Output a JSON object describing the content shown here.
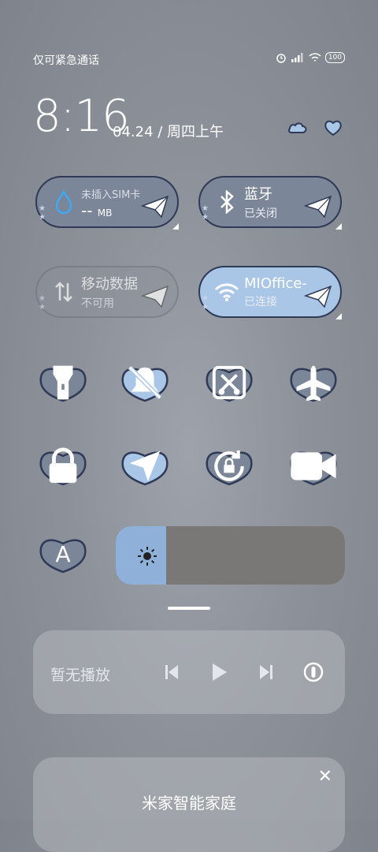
{
  "status": {
    "carrier_text": "仅可紧急通话",
    "battery": "100"
  },
  "clock": {
    "time": "8:16",
    "date": "04.24 / 周四上午"
  },
  "tiles": [
    {
      "title": "未插入SIM卡",
      "value": "-- ",
      "unit": "MB"
    },
    {
      "title": "蓝牙",
      "sub": "已关闭"
    },
    {
      "title": "移动数据",
      "sub": "不可用"
    },
    {
      "title": "MIOffice-",
      "sub": "已连接"
    }
  ],
  "toggles": [
    {
      "icon": "flashlight-icon",
      "active": false
    },
    {
      "icon": "mute-bell-icon",
      "active": true
    },
    {
      "icon": "screenshot-icon",
      "active": false
    },
    {
      "icon": "airplane-icon",
      "active": false
    },
    {
      "icon": "lock-icon",
      "active": false
    },
    {
      "icon": "location-icon",
      "active": true
    },
    {
      "icon": "rotation-lock-icon",
      "active": false
    },
    {
      "icon": "video-icon",
      "active": false
    },
    {
      "icon": "font-a-icon",
      "label": "A",
      "active": false
    }
  ],
  "brightness": {
    "level": 0.22
  },
  "media": {
    "title": "暂无播放"
  },
  "smart_home": {
    "title": "米家智能家庭",
    "close": "✕"
  },
  "colors": {
    "tile_dark": "#7b8698",
    "tile_blue": "#a9c6e6",
    "heart_dark": "#7b8698",
    "heart_blue": "#a9c6e6",
    "outline": "#2f3a57"
  }
}
